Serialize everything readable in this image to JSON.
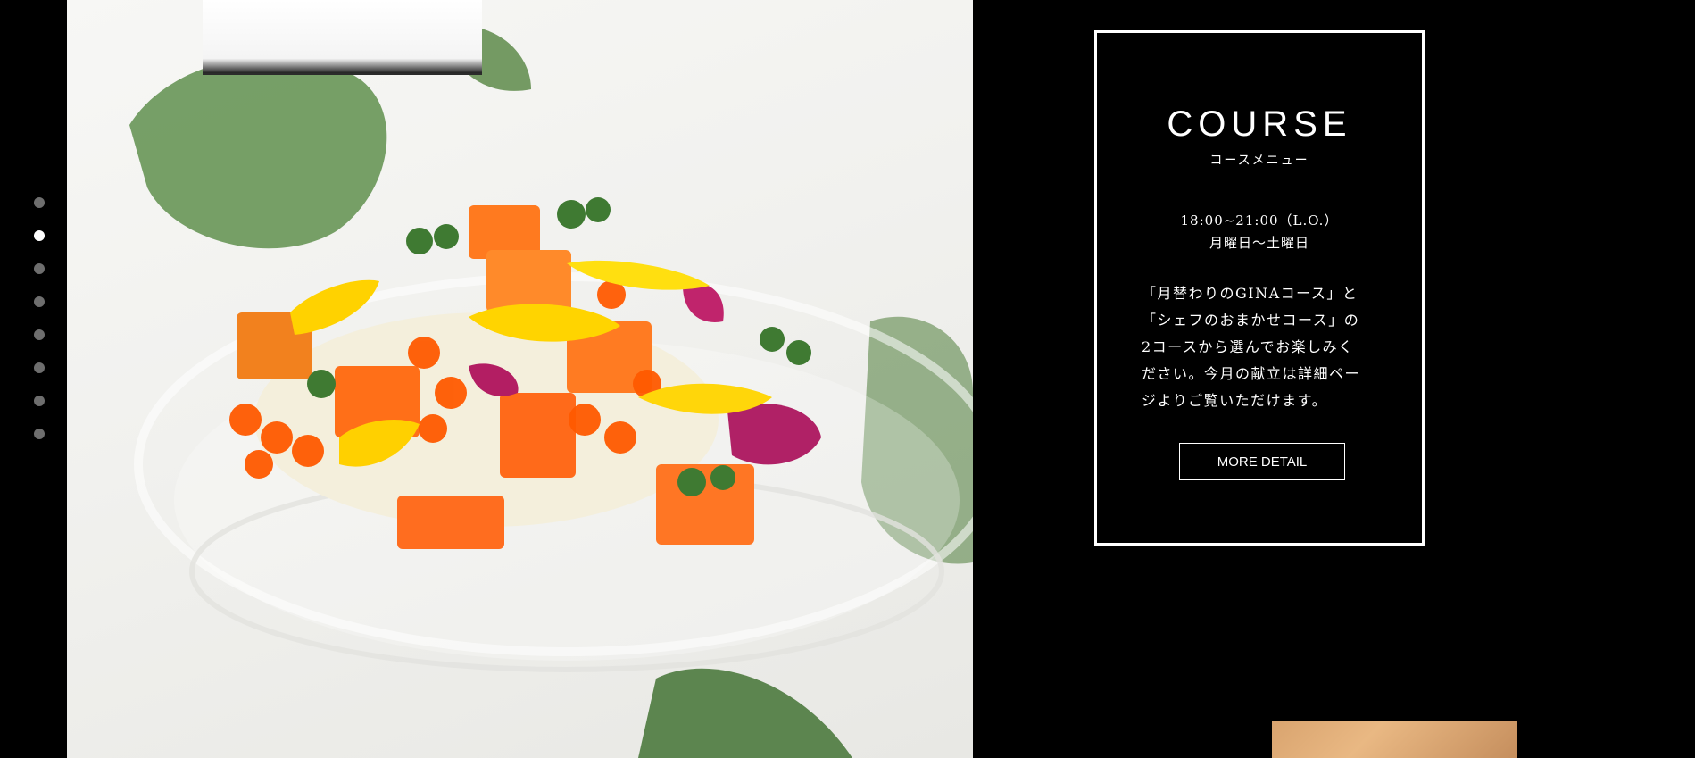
{
  "pager": {
    "dots": 8,
    "active_index": 1
  },
  "course": {
    "title": "COURSE",
    "subtitle": "コースメニュー",
    "hours": "18:00~21:00（L.O.）",
    "days": "月曜日～土曜日",
    "description_lines": [
      "「月替わりのGINAコース」と",
      "「シェフのおまかせコース」の",
      "2コースから選んでお楽しみく",
      "ださい。今月の献立は詳細ペー",
      "ジよりご覧いただけます。"
    ],
    "button_label": "MORE DETAIL"
  },
  "colors": {
    "background": "#000000",
    "card_border": "#ffffff",
    "dot_inactive": "#6e6e6e",
    "dot_active": "#ffffff"
  }
}
